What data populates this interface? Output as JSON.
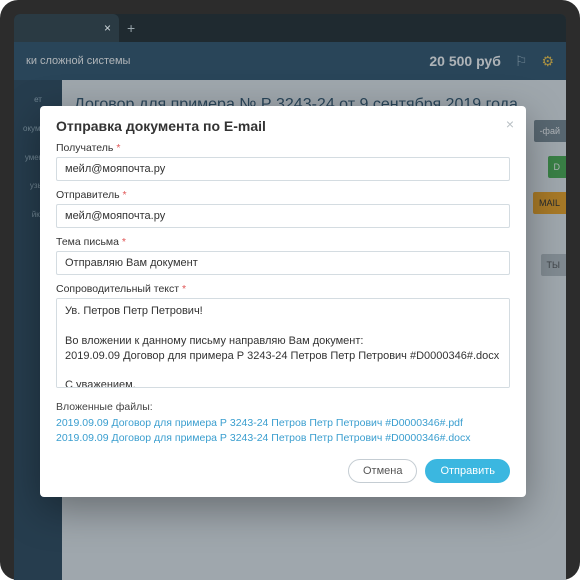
{
  "header": {
    "subtitle": "ки сложной системы",
    "price": "20 500 руб"
  },
  "sidebar": {
    "items": [
      "ет",
      "окумент",
      "ументо",
      "узья",
      "йки"
    ]
  },
  "main": {
    "doc_title": "Договор для примера № Р 3243-24 от 9 сентября 2019 года",
    "chips": {
      "c1": "-фай",
      "c2": "D",
      "c3": "MAIL",
      "c4": "ТЫ"
    }
  },
  "modal": {
    "title": "Отправка документа по E-mail",
    "recipient": {
      "label": "Получатель",
      "value": "мейл@мояпочта.ру"
    },
    "sender": {
      "label": "Отправитель",
      "value": "мейл@мояпочта.ру"
    },
    "subject": {
      "label": "Тема письма",
      "value": "Отправляю Вам документ"
    },
    "bodylabel": "Сопроводительный текст",
    "bodytext": "Ув. Петров Петр Петрович!\n\nВо вложении к данному письму направляю Вам документ:\n2019.09.09 Договор для примера Р 3243-24 Петров Петр Петрович #D0000346#.docx\n\nС уважением,\nИван\nмейл@мояпочта.ру",
    "att_label": "Вложенные файлы:",
    "attachments": [
      "2019.09.09 Договор для примера Р 3243-24 Петров Петр Петрович #D0000346#.pdf",
      "2019.09.09 Договор для примера Р 3243-24 Петров Петр Петрович #D0000346#.docx"
    ],
    "cancel": "Отмена",
    "send": "Отправить"
  }
}
